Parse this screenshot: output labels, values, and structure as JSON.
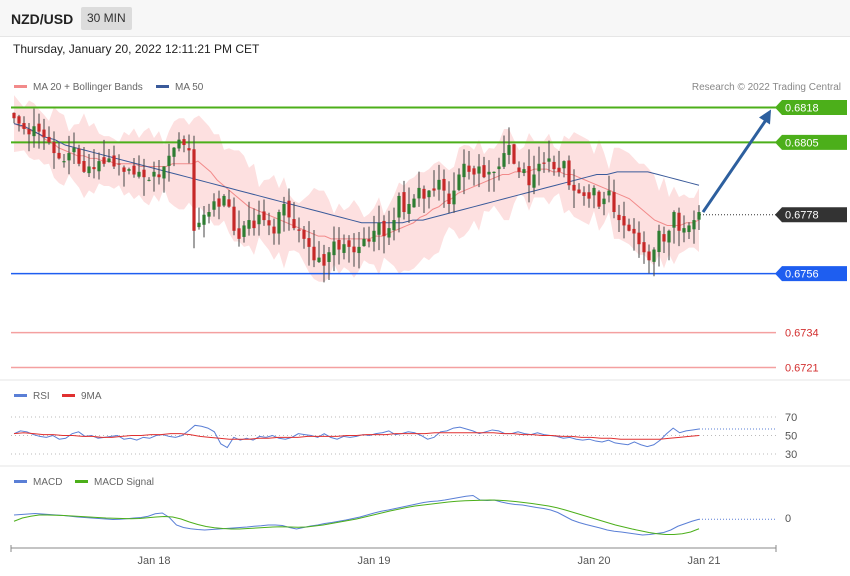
{
  "header": {
    "symbol": "NZD/USD",
    "interval": "30 MIN"
  },
  "datetime": "Thursday, January 20, 2022 12:11:21 PM CET",
  "copyright": "Research © 2022 Trading Central",
  "colors": {
    "candle_up": "#2e7d32",
    "candle_down": "#c62828",
    "bollinger_fill": "#fde0e0",
    "ma20": "#f28a8a",
    "ma50": "#3a5a9a",
    "resistance": "#4caf1a",
    "support": "#1e5ef0",
    "target_line": "#f4a0a0",
    "target_text": "#d32f2f",
    "current": "#333333",
    "arrow": "#2d5f9e",
    "rsi": "#5a7fd6",
    "rsi_ma": "#e03030",
    "macd": "#5a7fd6",
    "macd_signal": "#4caf1a"
  },
  "chart_data": [
    {
      "type": "candlestick",
      "title": "NZD/USD",
      "legend": [
        {
          "name": "MA 20 + Bollinger Bands",
          "color": "#f28a8a"
        },
        {
          "name": "MA 50",
          "color": "#3a5a9a"
        }
      ],
      "ylim": [
        0.6716,
        0.6828
      ],
      "x_ticks": [
        {
          "label": "Jan 18",
          "index": 28
        },
        {
          "label": "Jan 19",
          "index": 72
        },
        {
          "label": "Jan 20",
          "index": 116
        },
        {
          "label": "Jan 21",
          "index": 138
        }
      ],
      "levels": [
        {
          "label": "0.6818",
          "value": 0.6818,
          "kind": "resistance"
        },
        {
          "label": "0.6805",
          "value": 0.6805,
          "kind": "resistance"
        },
        {
          "label": "0.6778",
          "value": 0.6778,
          "kind": "current"
        },
        {
          "label": "0.6756",
          "value": 0.6756,
          "kind": "support"
        },
        {
          "label": "0.6734",
          "value": 0.6734,
          "kind": "target"
        },
        {
          "label": "0.6721",
          "value": 0.6721,
          "kind": "target"
        }
      ],
      "series": [
        {
          "name": "NZD/USD",
          "close": [
            0.6814,
            0.6812,
            0.681,
            0.6808,
            0.6811,
            0.6809,
            0.6807,
            0.6805,
            0.6801,
            0.6799,
            0.6798,
            0.6801,
            0.6803,
            0.6797,
            0.6794,
            0.6796,
            0.6795,
            0.6798,
            0.6797,
            0.6799,
            0.6796,
            0.6797,
            0.6794,
            0.6795,
            0.6793,
            0.6794,
            0.6792,
            0.6791,
            0.6794,
            0.6792,
            0.6796,
            0.68,
            0.6803,
            0.6806,
            0.6804,
            0.6802,
            0.6772,
            0.6775,
            0.6778,
            0.6779,
            0.6783,
            0.6781,
            0.6785,
            0.6781,
            0.6772,
            0.6769,
            0.6774,
            0.6776,
            0.6773,
            0.6778,
            0.6776,
            0.6774,
            0.6771,
            0.6779,
            0.6782,
            0.6777,
            0.6773,
            0.6772,
            0.6769,
            0.6766,
            0.6761,
            0.6762,
            0.6759,
            0.6764,
            0.6768,
            0.6765,
            0.6767,
            0.6766,
            0.6764,
            0.6766,
            0.6769,
            0.6768,
            0.6772,
            0.6775,
            0.677,
            0.6773,
            0.6776,
            0.6785,
            0.6779,
            0.6782,
            0.6784,
            0.6788,
            0.6784,
            0.6787,
            0.6787,
            0.6791,
            0.6787,
            0.6782,
            0.6787,
            0.6793,
            0.6797,
            0.6794,
            0.6793,
            0.6796,
            0.6792,
            0.6794,
            0.6794,
            0.6796,
            0.6801,
            0.6804,
            0.6797,
            0.6794,
            0.6795,
            0.6789,
            0.6793,
            0.6797,
            0.6797,
            0.6799,
            0.6795,
            0.6794,
            0.6798,
            0.6789,
            0.6787,
            0.6786,
            0.6785,
            0.6784,
            0.6788,
            0.6781,
            0.6784,
            0.6787,
            0.6779,
            0.6776,
            0.6774,
            0.6772,
            0.6771,
            0.6767,
            0.6764,
            0.6761,
            0.6765,
            0.6772,
            0.6768,
            0.6772,
            0.6779,
            0.6772,
            0.6773,
            0.6774,
            0.6776,
            0.6779
          ]
        },
        {
          "name": "MA 20",
          "values": [
            0.6812,
            0.6811,
            0.681,
            0.6809,
            0.6808,
            0.6806,
            0.6805,
            0.6803,
            0.6802,
            0.6801,
            0.68,
            0.68,
            0.6799,
            0.6799,
            0.6798,
            0.6798,
            0.6797,
            0.6797,
            0.6797,
            0.6797,
            0.6796,
            0.6796,
            0.6796,
            0.6796,
            0.6796,
            0.6797,
            0.6797,
            0.6797,
            0.6797,
            0.6798,
            0.6796,
            0.6794,
            0.6791,
            0.6789,
            0.6787,
            0.6785,
            0.6783,
            0.6781,
            0.678,
            0.6779,
            0.6778,
            0.6777,
            0.6776,
            0.6775,
            0.6774,
            0.6773,
            0.6772,
            0.6771,
            0.677,
            0.677,
            0.6769,
            0.6769,
            0.6769,
            0.6769,
            0.6769,
            0.6769,
            0.6769,
            0.677,
            0.677,
            0.6771,
            0.6772,
            0.6773,
            0.6774,
            0.6775,
            0.6777,
            0.6778,
            0.678,
            0.6781,
            0.6783,
            0.6784,
            0.6786,
            0.6787,
            0.6788,
            0.6789,
            0.679,
            0.6791,
            0.6792,
            0.6793,
            0.6793,
            0.6794,
            0.6794,
            0.6794,
            0.6795,
            0.6795,
            0.6795,
            0.6794,
            0.6794,
            0.6793,
            0.6793,
            0.6792,
            0.6791,
            0.679,
            0.6789,
            0.6788,
            0.6787,
            0.6786,
            0.6785,
            0.6784,
            0.6782,
            0.678,
            0.6778,
            0.6776,
            0.6775,
            0.6774,
            0.6774,
            0.6774,
            0.6775,
            0.6775,
            0.6776
          ]
        },
        {
          "name": "MA 50",
          "values": [
            0.6812,
            0.6811,
            0.6809,
            0.6807,
            0.6806,
            0.6804,
            0.6803,
            0.6802,
            0.6801,
            0.68,
            0.6799,
            0.6798,
            0.6797,
            0.6796,
            0.6795,
            0.6794,
            0.6793,
            0.6792,
            0.6791,
            0.679,
            0.6789,
            0.6788,
            0.6787,
            0.6786,
            0.6785,
            0.6784,
            0.6783,
            0.6782,
            0.6781,
            0.678,
            0.6779,
            0.6778,
            0.6777,
            0.6776,
            0.6775,
            0.6775,
            0.6775,
            0.6775,
            0.6775,
            0.6776,
            0.6776,
            0.6777,
            0.6778,
            0.6779,
            0.678,
            0.6781,
            0.6782,
            0.6783,
            0.6784,
            0.6785,
            0.6786,
            0.6787,
            0.6788,
            0.6789,
            0.679,
            0.6791,
            0.6792,
            0.6793,
            0.6793,
            0.6794,
            0.6794,
            0.6794,
            0.6794,
            0.6793,
            0.6792,
            0.6791,
            0.679,
            0.6789
          ]
        }
      ]
    },
    {
      "type": "line",
      "legend": [
        {
          "name": "RSI",
          "color": "#5a7fd6"
        },
        {
          "name": "9MA",
          "color": "#e03030"
        }
      ],
      "ylim": [
        25,
        80
      ],
      "y_ticks": [
        70,
        50,
        30
      ],
      "series": [
        {
          "name": "RSI",
          "values": [
            52,
            55,
            54,
            51,
            49,
            48,
            50,
            46,
            47,
            52,
            54,
            49,
            50,
            47,
            48,
            49,
            50,
            46,
            47,
            45,
            48,
            47,
            50,
            51,
            49,
            48,
            50,
            55,
            61,
            60,
            58,
            54,
            41,
            37,
            48,
            45,
            47,
            45,
            49,
            48,
            50,
            47,
            46,
            48,
            52,
            51,
            50,
            48,
            52,
            48,
            46,
            49,
            48,
            49,
            51,
            50,
            52,
            53,
            55,
            51,
            52,
            54,
            53,
            50,
            46,
            48,
            54,
            55,
            58,
            59,
            57,
            55,
            52,
            54,
            56,
            55,
            52,
            52,
            54,
            52,
            51,
            53,
            51,
            50,
            49,
            47,
            48,
            46,
            45,
            46,
            44,
            43,
            45,
            42,
            41,
            40,
            43,
            40,
            38,
            40,
            45,
            52,
            58,
            53,
            55,
            56,
            57
          ]
        },
        {
          "name": "9MA",
          "values": [
            52,
            53,
            52,
            51,
            51,
            50,
            50,
            49,
            49,
            48,
            48,
            49,
            50,
            50,
            51,
            51,
            52,
            52,
            51,
            49,
            48,
            47,
            46,
            46,
            46,
            47,
            47,
            48,
            48,
            48,
            49,
            49,
            49,
            49,
            50,
            50,
            51,
            51,
            51,
            52,
            52,
            52,
            52,
            53,
            53,
            53,
            53,
            53,
            53,
            53,
            52,
            52,
            51,
            51,
            50,
            50,
            49,
            49,
            48,
            48,
            47,
            47,
            46,
            46,
            46,
            46,
            46,
            47,
            48,
            49,
            50
          ]
        }
      ]
    },
    {
      "type": "line",
      "legend": [
        {
          "name": "MACD",
          "color": "#5a7fd6"
        },
        {
          "name": "MACD Signal",
          "color": "#4caf1a"
        }
      ],
      "ylim": [
        -0.0012,
        0.0012
      ],
      "y_ticks": [
        0
      ],
      "series": [
        {
          "name": "MACD",
          "values": [
            0.0002,
            0.00022,
            0.00024,
            0.00026,
            0.00024,
            0.00022,
            0.0002,
            0.00018,
            0.00015,
            0.00012,
            0.0001,
            8e-05,
            6e-05,
            4e-05,
            2e-05,
            3e-05,
            5e-05,
            8e-05,
            0.0001,
            0.00015,
            0.00025,
            0.00028,
            0.0001,
            -0.0002,
            -0.0003,
            -0.00035,
            -0.00038,
            -0.0004,
            -0.00038,
            -0.00036,
            -0.00034,
            -0.00032,
            -0.0003,
            -0.00028,
            -0.00025,
            -0.00023,
            -0.0002,
            -0.0002,
            -0.00022,
            -0.0003,
            -0.00036,
            -0.0003,
            -0.00024,
            -0.0002,
            -0.00014,
            -0.0001,
            -5e-05,
            0.0,
            6e-05,
            0.00012,
            0.0002,
            0.00028,
            0.00035,
            0.0004,
            0.00046,
            0.00052,
            0.00058,
            0.00064,
            0.0007,
            0.00074,
            0.00076,
            0.0008,
            0.00085,
            0.0009,
            0.00095,
            0.00098,
            0.0008,
            0.00078,
            0.0008,
            0.00072,
            0.00066,
            0.00062,
            0.0006,
            0.00055,
            0.0005,
            0.00046,
            0.0004,
            0.0003,
            0.00015,
            0.0,
            -0.0001,
            -0.00018,
            -0.00025,
            -0.00032,
            -0.0004,
            -0.00045,
            -0.00048,
            -0.00052,
            -0.00056,
            -0.0006,
            -0.00058,
            -0.00054,
            -0.0005,
            -0.0004,
            -0.00025,
            -0.00015,
            -5e-05,
            3e-05
          ]
        },
        {
          "name": "MACD Signal",
          "values": [
            -5e-05,
            8e-05,
            0.00015,
            0.0002,
            0.0002,
            0.00019,
            0.00018,
            0.00016,
            0.00014,
            0.00012,
            0.0001,
            8e-05,
            7e-05,
            6e-05,
            5e-05,
            6e-05,
            9e-05,
            0.00012,
            0.00014,
            0.00012,
            4e-05,
            -8e-05,
            -0.00018,
            -0.00026,
            -0.00031,
            -0.00034,
            -0.00036,
            -0.00036,
            -0.00034,
            -0.00032,
            -0.0003,
            -0.00028,
            -0.00027,
            -0.00028,
            -0.00029,
            -0.00028,
            -0.00024,
            -0.0002,
            -0.00014,
            -8e-05,
            -2e-05,
            4e-05,
            0.00012,
            0.0002,
            0.00028,
            0.00036,
            0.00043,
            0.0005,
            0.00056,
            0.0006,
            0.00064,
            0.00068,
            0.00072,
            0.00075,
            0.00077,
            0.00078,
            0.00079,
            0.0008,
            0.00079,
            0.00077,
            0.00074,
            0.0007,
            0.00066,
            0.00061,
            0.00056,
            0.00049,
            0.0004,
            0.0003,
            0.0002,
            0.0001,
            0.0,
            -0.0001,
            -0.0002,
            -0.00028,
            -0.00036,
            -0.00043,
            -0.0005,
            -0.00055,
            -0.00058,
            -0.00058,
            -0.00055,
            -0.00048,
            -0.00035
          ]
        }
      ]
    }
  ]
}
